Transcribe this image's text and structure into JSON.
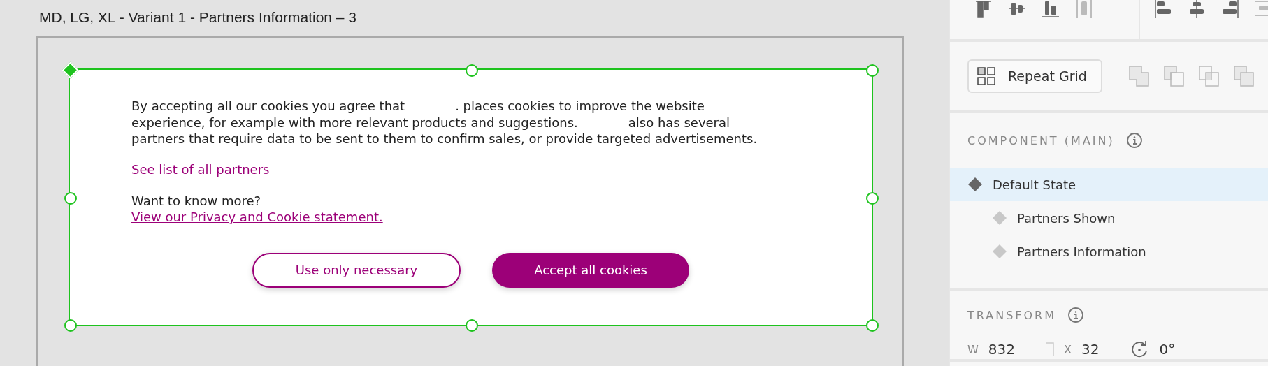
{
  "artboard": {
    "title": "MD, LG, XL - Variant 1 - Partners Information – 3"
  },
  "banner": {
    "paragraph": [
      [
        "By accepting all our cookies you agree that",
        ". places cookies to improve the website"
      ],
      [
        "experience, for example with more relevant products and suggestions.",
        "also has several"
      ],
      [
        "partners that require data to be sent to them to confirm sales, or provide targeted advertisements."
      ]
    ],
    "partners_link": "See list of all partners",
    "more_question": "Want to know more?",
    "privacy_link": "View our Privacy and Cookie statement.",
    "buttons": [
      {
        "label": "Use only necessary",
        "kind": "outline"
      },
      {
        "label": "Accept all cookies",
        "kind": "filled"
      }
    ]
  },
  "inspector": {
    "repeat_grid": "Repeat Grid",
    "component_heading": "COMPONENT (MAIN)",
    "states": [
      {
        "label": "Default State",
        "selected": true,
        "children": [
          {
            "label": "Partners Shown",
            "selected": false
          },
          {
            "label": "Partners Information",
            "selected": false
          }
        ]
      }
    ],
    "transform_heading": "TRANSFORM",
    "fields": [
      {
        "label": "W",
        "value": "832"
      },
      {
        "label": "X",
        "value": "32"
      }
    ],
    "rotation": "0°"
  }
}
